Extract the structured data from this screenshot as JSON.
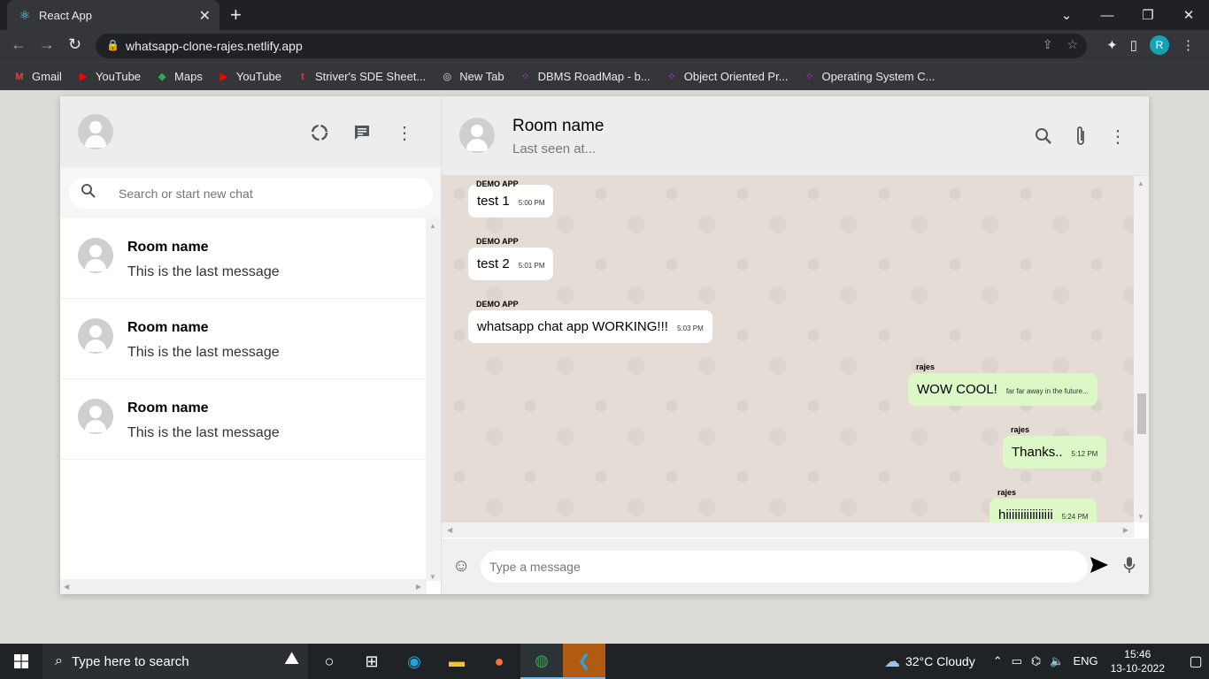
{
  "browser": {
    "tab_title": "React App",
    "url": "whatsapp-clone-rajes.netlify.app",
    "profile_initial": "R",
    "bookmarks": [
      {
        "label": "Gmail",
        "icon": "gmail-icon",
        "color": "#ea4335"
      },
      {
        "label": "YouTube",
        "icon": "youtube-icon",
        "color": "#ff0000"
      },
      {
        "label": "Maps",
        "icon": "maps-icon",
        "color": "#34a853"
      },
      {
        "label": "YouTube",
        "icon": "youtube-icon",
        "color": "#ff0000"
      },
      {
        "label": "Striver's SDE Sheet...",
        "icon": "tuf-icon",
        "color": "#e53935"
      },
      {
        "label": "New Tab",
        "icon": "globe-icon",
        "color": "#9aa0a6"
      },
      {
        "label": "DBMS RoadMap - b...",
        "icon": "dots-icon",
        "color": "#c026d3"
      },
      {
        "label": "Object Oriented Pr...",
        "icon": "dots-icon",
        "color": "#c026d3"
      },
      {
        "label": "Operating System C...",
        "icon": "dots-icon",
        "color": "#c026d3"
      }
    ]
  },
  "sidebar": {
    "search_placeholder": "Search or start new chat",
    "chats": [
      {
        "name": "Room name",
        "last": "This is the last message"
      },
      {
        "name": "Room name",
        "last": "This is the last message"
      },
      {
        "name": "Room name",
        "last": "This is the last message"
      }
    ]
  },
  "chat": {
    "title": "Room name",
    "subtitle": "Last seen at...",
    "input_placeholder": "Type a message",
    "messages": [
      {
        "sender": "DEMO APP",
        "text": "test 1",
        "time": "5:00 PM"
      },
      {
        "sender": "DEMO APP",
        "text": "test 2",
        "time": "5:01 PM"
      },
      {
        "sender": "DEMO APP",
        "text": "whatsapp chat app WORKING!!!",
        "time": "5:03 PM"
      },
      {
        "sender": "rajes",
        "text": "WOW COOL!",
        "time": "far far away in the future..."
      },
      {
        "sender": "rajes",
        "text": "Thanks..",
        "time": "5:12 PM"
      },
      {
        "sender": "rajes",
        "text": "hiiiiiiiiiiiiiiii",
        "time": "5:24 PM"
      }
    ]
  },
  "taskbar": {
    "search_placeholder": "Type here to search",
    "weather": "32°C  Cloudy",
    "lang": "ENG",
    "time": "15:46",
    "date": "13-10-2022"
  },
  "colors": {
    "outgoing_bubble": "#dcf8c6",
    "chat_background": "#e5ddd5",
    "header_background": "#ededed"
  }
}
